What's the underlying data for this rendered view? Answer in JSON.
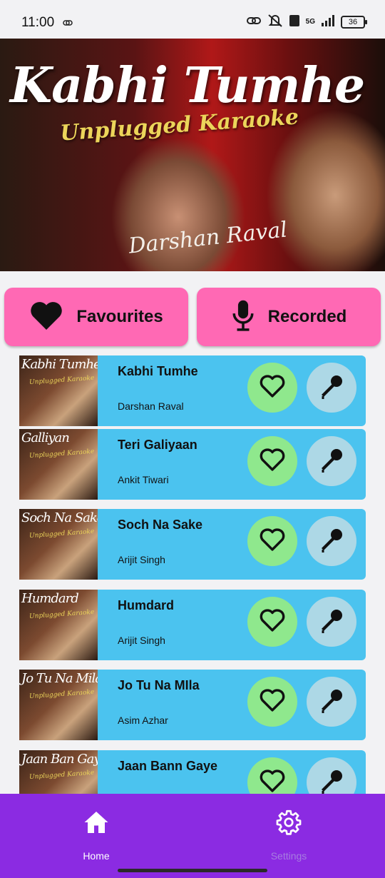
{
  "status_bar": {
    "time": "11:00",
    "network": "5G",
    "battery": "36"
  },
  "hero": {
    "title": "Kabhi Tumhe",
    "subtitle": "Unplugged Karaoke",
    "artist": "Darshan Raval"
  },
  "buttons": {
    "favourites": "Favourites",
    "recorded": "Recorded"
  },
  "songs": [
    {
      "title": "Kabhi Tumhe",
      "artist": "Darshan Raval",
      "thumb_text": "Kabhi Tumhe",
      "thumb_sub": "Unplugged Karaoke"
    },
    {
      "title": "Teri Galiyaan",
      "artist": "Ankit Tiwari",
      "thumb_text": "Galliyan",
      "thumb_sub": "Unplugged Karaoke"
    },
    {
      "title": "Soch Na Sake",
      "artist": "Arijit Singh",
      "thumb_text": "Soch Na Sake",
      "thumb_sub": "Unplugged Karaoke"
    },
    {
      "title": "Humdard",
      "artist": "Arijit Singh",
      "thumb_text": "Humdard",
      "thumb_sub": "Unplugged Karaoke"
    },
    {
      "title": "Jo Tu Na MIla",
      "artist": "Asim Azhar",
      "thumb_text": "Jo Tu Na Mila",
      "thumb_sub": "Unplugged Karaoke"
    },
    {
      "title": "Jaan Bann Gaye",
      "artist": "",
      "thumb_text": "Jaan Ban Gaye",
      "thumb_sub": "Unplugged Karaoke"
    }
  ],
  "nav": {
    "home": "Home",
    "settings": "Settings"
  },
  "colors": {
    "accent_pink": "#ff69b4",
    "row_blue": "#4bc3ef",
    "fav_green": "#8fe88d",
    "mic_blue": "#add8e6",
    "nav_purple": "#8b2be2"
  }
}
